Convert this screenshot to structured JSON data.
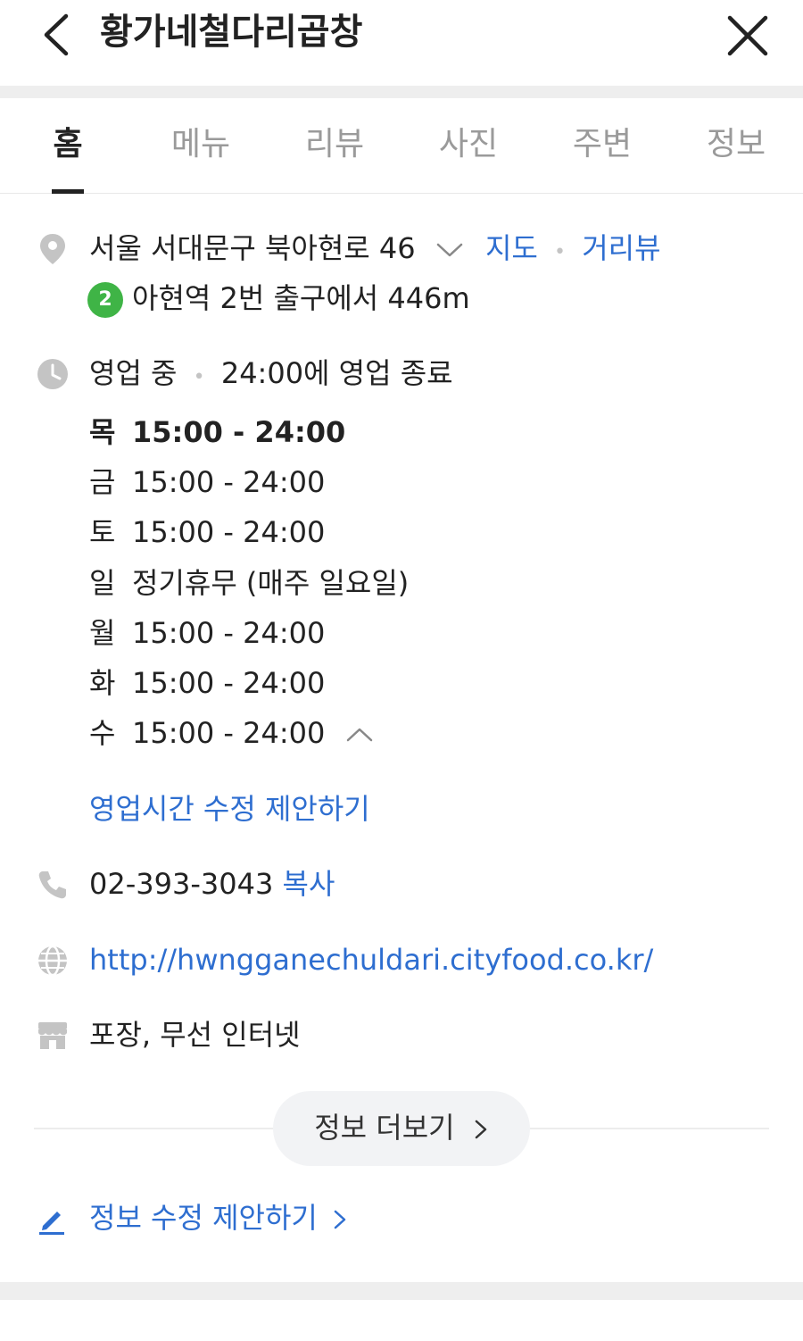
{
  "header": {
    "title": "황가네철다리곱창"
  },
  "tabs": [
    {
      "label": "홈",
      "active": true
    },
    {
      "label": "메뉴"
    },
    {
      "label": "리뷰"
    },
    {
      "label": "사진"
    },
    {
      "label": "주변"
    },
    {
      "label": "정보"
    }
  ],
  "address": {
    "text": "서울 서대문구 북아현로 46",
    "map_link": "지도",
    "separator": "•",
    "streetview_link": "거리뷰"
  },
  "subway": {
    "line": "2",
    "line_color": "#3fb446",
    "text": "아현역 2번 출구에서 446m"
  },
  "business": {
    "status": "영업 중",
    "separator": "•",
    "close_text": "24:00에 영업 종료"
  },
  "hours": [
    {
      "day": "목",
      "time": "15:00 - 24:00"
    },
    {
      "day": "금",
      "time": "15:00 - 24:00"
    },
    {
      "day": "토",
      "time": "15:00 - 24:00"
    },
    {
      "day": "일",
      "time": "정기휴무 (매주 일요일)"
    },
    {
      "day": "월",
      "time": "15:00 - 24:00"
    },
    {
      "day": "화",
      "time": "15:00 - 24:00"
    },
    {
      "day": "수",
      "time": "15:00 - 24:00"
    }
  ],
  "hours_edit_link": "영업시간 수정 제안하기",
  "phone": {
    "number": "02-393-3043",
    "copy_label": "복사"
  },
  "website": {
    "url": "http://hwngganechuldari.cityfood.co.kr/"
  },
  "amenities": {
    "text": "포장, 무선 인터넷"
  },
  "more_info_button": "정보 더보기",
  "edit_suggest_link": "정보 수정 제안하기",
  "colors": {
    "link": "#2e6ed0",
    "icon_gray": "#c4c4c4"
  },
  "icons": {
    "back": "chevron-left-icon",
    "close": "close-icon",
    "location": "location-pin-icon",
    "clock": "clock-icon",
    "phone": "phone-icon",
    "globe": "globe-icon",
    "store": "store-icon",
    "pencil": "pencil-icon"
  }
}
